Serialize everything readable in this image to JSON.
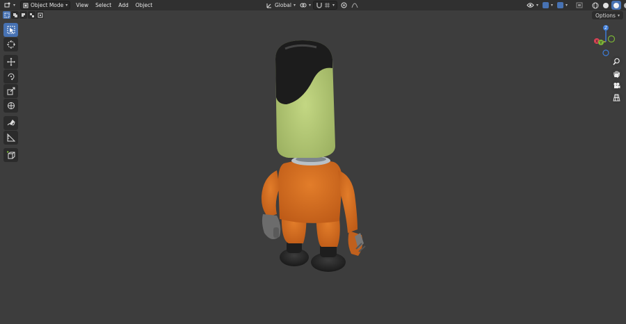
{
  "header": {
    "mode_label": "Object Mode",
    "menus": [
      "View",
      "Select",
      "Add",
      "Object"
    ],
    "orientation_label": "Global"
  },
  "viewport": {
    "options_label": "Options"
  },
  "colors": {
    "background": "#3d3d3d",
    "header": "#303030",
    "active": "#4772b3",
    "axis_x": "#e04356",
    "axis_y": "#7bb536",
    "axis_z": "#3d7cd8"
  },
  "gizmo": {
    "axis_x": "X",
    "axis_y": "Y",
    "axis_z": "Z"
  },
  "tools": [
    "select-box-icon",
    "cursor-icon",
    "move-icon",
    "rotate-icon",
    "scale-icon",
    "transform-icon",
    "annotate-icon",
    "measure-icon",
    "add-cube-icon"
  ],
  "nav": [
    "zoom-icon",
    "pan-hand-icon",
    "camera-icon",
    "perspective-grid-icon"
  ]
}
